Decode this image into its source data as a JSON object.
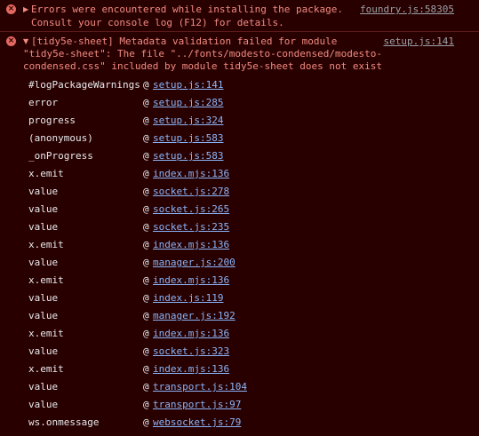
{
  "messages": [
    {
      "icon": "error-icon",
      "lines": [
        "Errors were encountered while installing the package.",
        "Consult your console log (F12) for details."
      ],
      "source": "foundry.js:58305"
    },
    {
      "icon": "error-icon",
      "lines": [
        "[tidy5e-sheet] Metadata validation failed for module",
        "\"tidy5e-sheet\": The file \"../fonts/modesto-condensed/modesto-",
        "condensed.css\" included by module tidy5e-sheet does not exist"
      ],
      "source": "setup.js:141"
    }
  ],
  "stack": [
    {
      "fn": "#logPackageWarnings",
      "loc": "setup.js:141"
    },
    {
      "fn": "error",
      "loc": "setup.js:285"
    },
    {
      "fn": "progress",
      "loc": "setup.js:324"
    },
    {
      "fn": "(anonymous)",
      "loc": "setup.js:583"
    },
    {
      "fn": "_onProgress",
      "loc": "setup.js:583"
    },
    {
      "fn": "x.emit",
      "loc": "index.mjs:136"
    },
    {
      "fn": "value",
      "loc": "socket.js:278"
    },
    {
      "fn": "value",
      "loc": "socket.js:265"
    },
    {
      "fn": "value",
      "loc": "socket.js:235"
    },
    {
      "fn": "x.emit",
      "loc": "index.mjs:136"
    },
    {
      "fn": "value",
      "loc": "manager.js:200"
    },
    {
      "fn": "x.emit",
      "loc": "index.mjs:136"
    },
    {
      "fn": "value",
      "loc": "index.js:119"
    },
    {
      "fn": "value",
      "loc": "manager.js:192"
    },
    {
      "fn": "x.emit",
      "loc": "index.mjs:136"
    },
    {
      "fn": "value",
      "loc": "socket.js:323"
    },
    {
      "fn": "x.emit",
      "loc": "index.mjs:136"
    },
    {
      "fn": "value",
      "loc": "transport.js:104"
    },
    {
      "fn": "value",
      "loc": "transport.js:97"
    },
    {
      "fn": "ws.onmessage",
      "loc": "websocket.js:79"
    }
  ],
  "at_symbol": "@",
  "error_glyph": "×",
  "expand_glyph": "▶",
  "collapse_glyph": "▼",
  "colors": {
    "background": "#290000",
    "error_text": "#f28b82",
    "link": "#8ab4f8",
    "source_link": "#9aa0a6"
  }
}
